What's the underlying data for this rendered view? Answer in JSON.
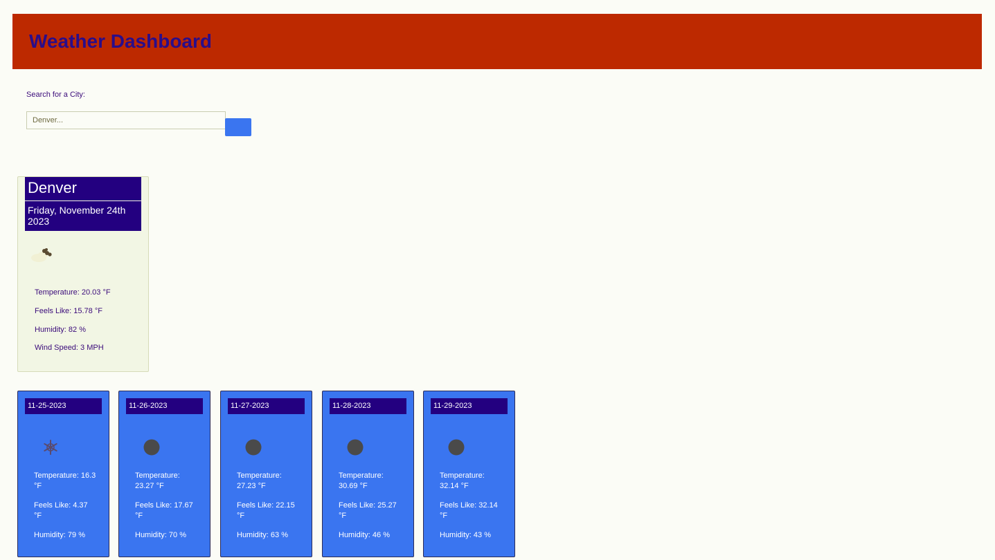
{
  "header": {
    "title": "Weather Dashboard"
  },
  "search": {
    "label": "Search for a City:",
    "placeholder": "Denver..."
  },
  "current": {
    "city": "Denver",
    "date": "Friday, November 24th 2023",
    "icon": "partly-cloudy-icon",
    "temperature": "Temperature: 20.03 °F",
    "feels_like": "Feels Like: 15.78 °F",
    "humidity": "Humidity: 82 %",
    "wind": "Wind Speed: 3 MPH"
  },
  "forecast": [
    {
      "date": "11-25-2023",
      "icon": "snowflake-icon",
      "temperature": "Temperature: 16.3 °F",
      "feels_like": "Feels Like: 4.37 °F",
      "humidity": "Humidity: 79 %"
    },
    {
      "date": "11-26-2023",
      "icon": "clear-icon",
      "temperature": "Temperature: 23.27 °F",
      "feels_like": "Feels Like: 17.67 °F",
      "humidity": "Humidity: 70 %"
    },
    {
      "date": "11-27-2023",
      "icon": "clear-icon",
      "temperature": "Temperature: 27.23 °F",
      "feels_like": "Feels Like: 22.15 °F",
      "humidity": "Humidity: 63 %"
    },
    {
      "date": "11-28-2023",
      "icon": "clear-icon",
      "temperature": "Temperature: 30.69 °F",
      "feels_like": "Feels Like: 25.27 °F",
      "humidity": "Humidity: 46 %"
    },
    {
      "date": "11-29-2023",
      "icon": "clear-icon",
      "temperature": "Temperature: 32.14 °F",
      "feels_like": "Feels Like: 32.14 °F",
      "humidity": "Humidity: 43 %"
    }
  ],
  "colors": {
    "header_bg": "#bd2900",
    "title": "#2a0d8a",
    "accent_blue": "#3a75f0",
    "label_navy": "#230080",
    "page_bg": "#fbfcf6"
  }
}
